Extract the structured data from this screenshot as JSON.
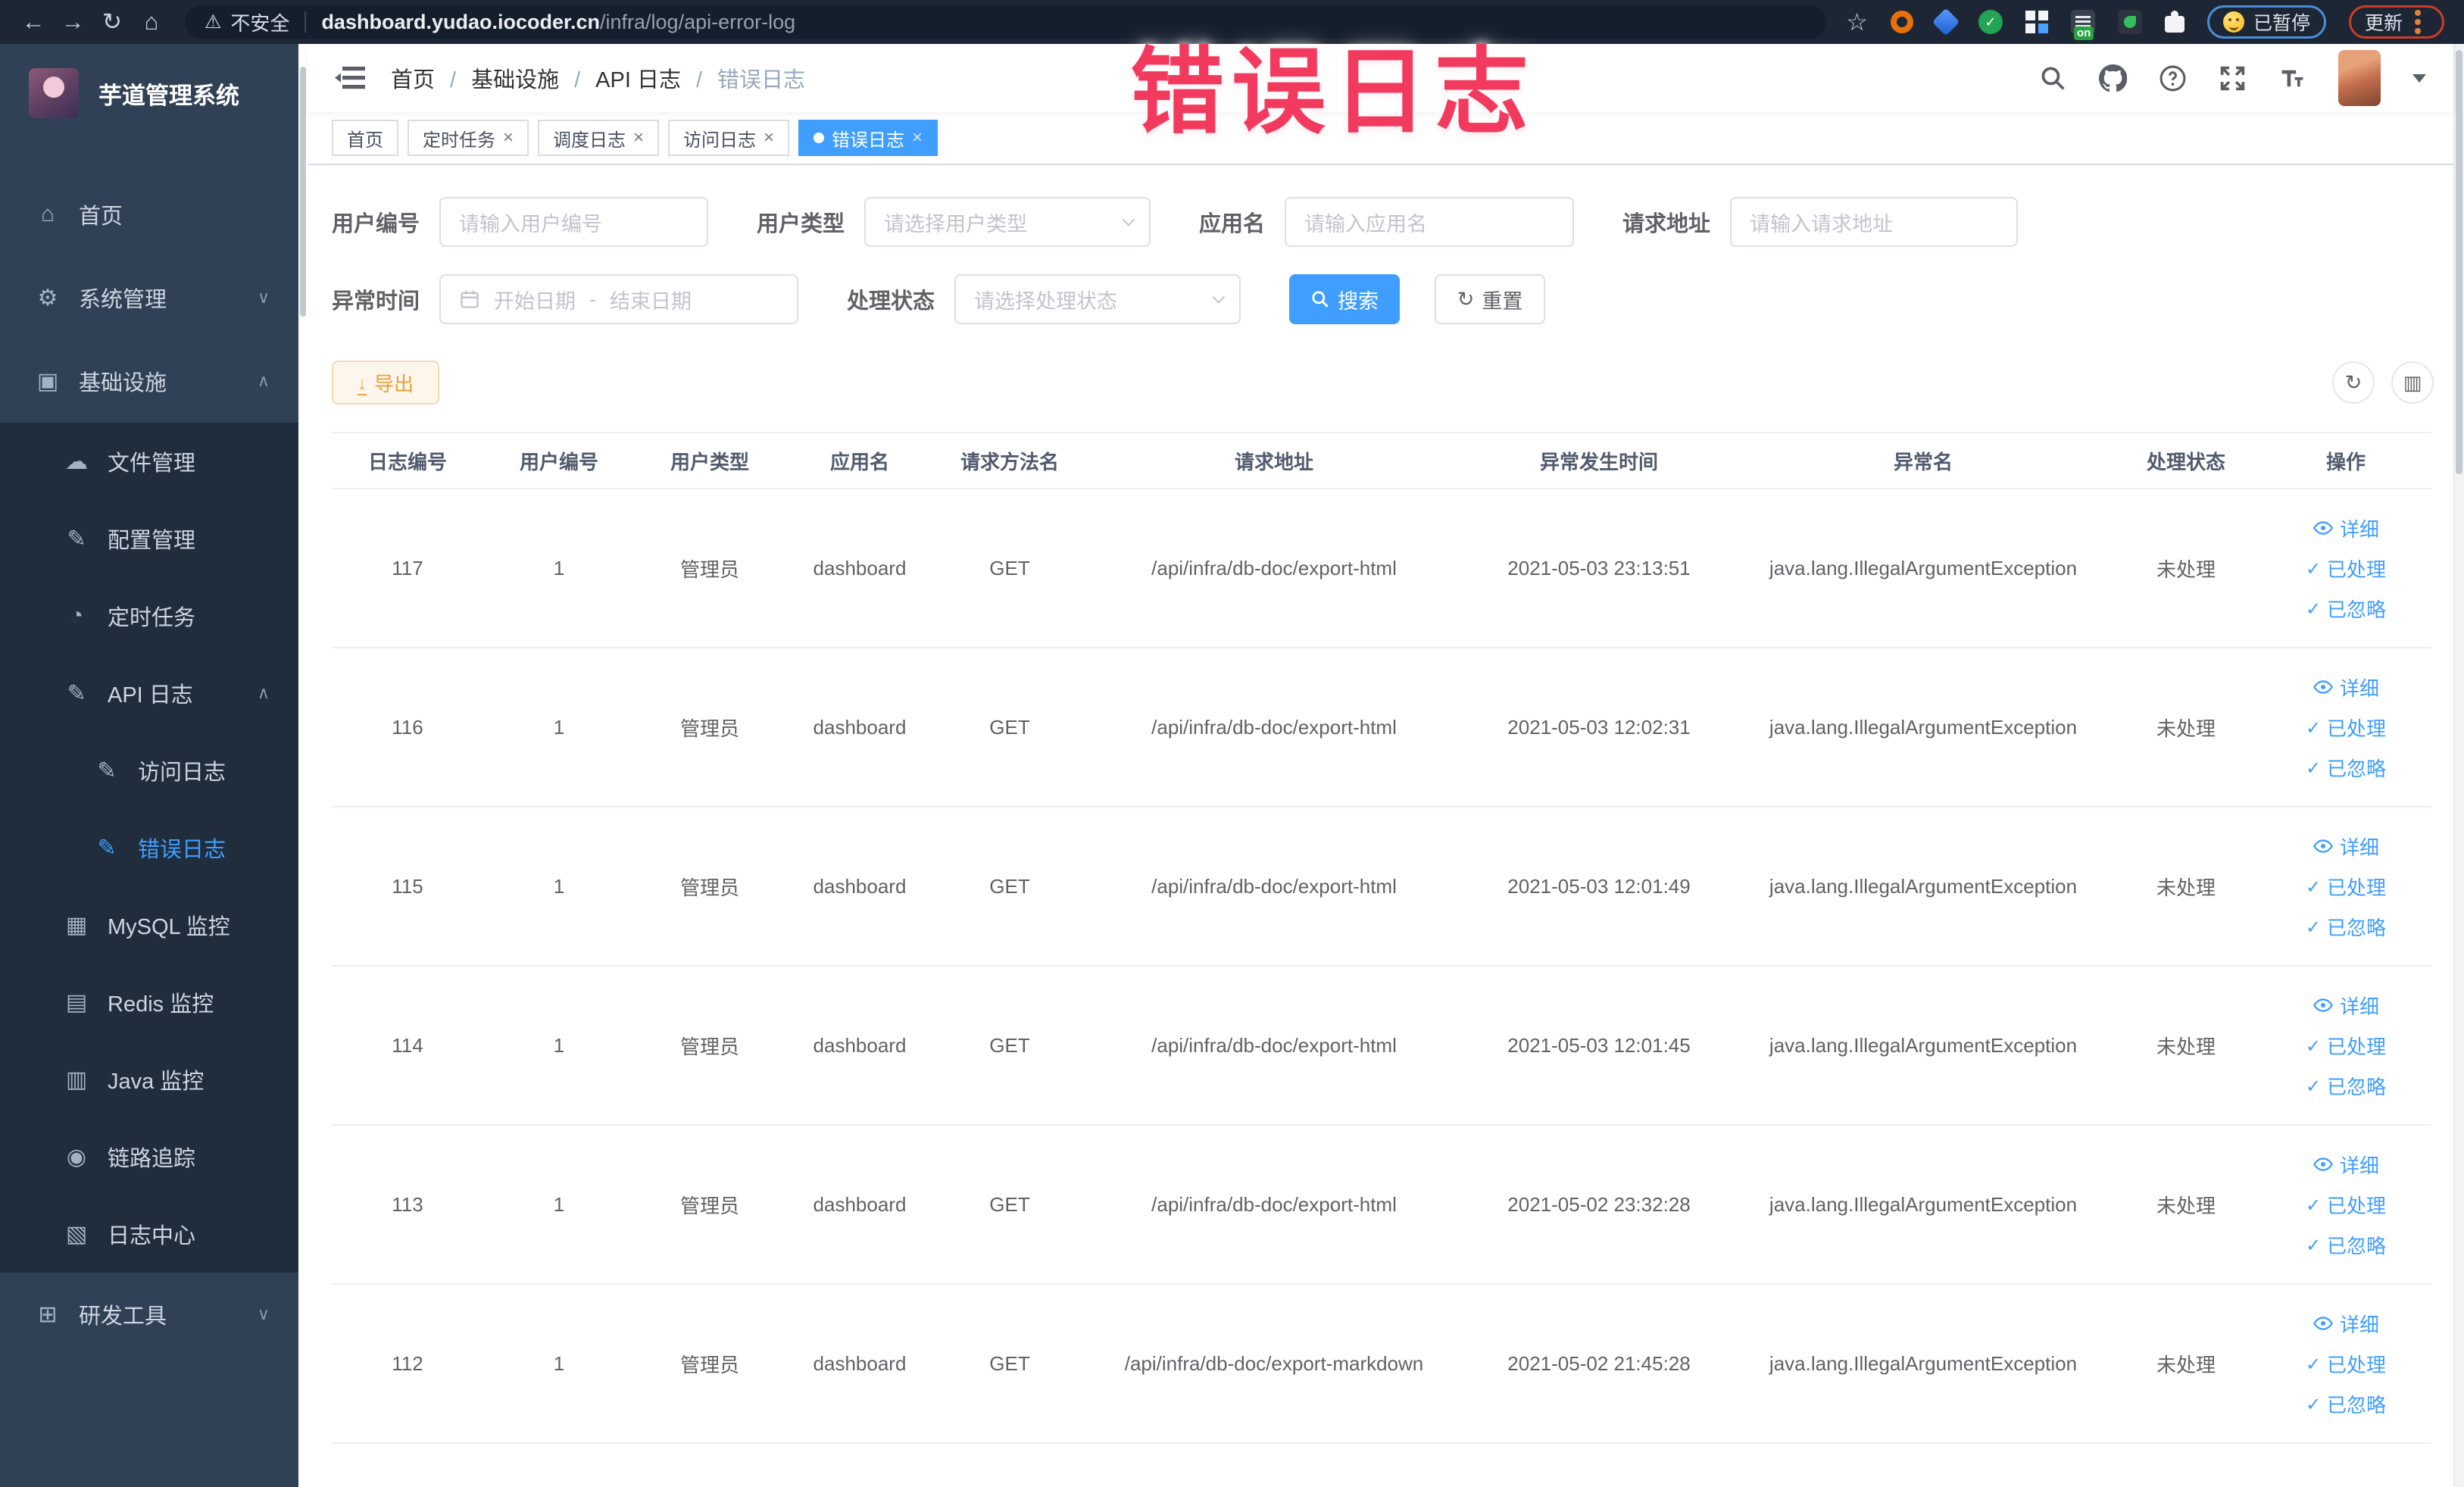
{
  "theme": {
    "primary": "#409eff",
    "warning": "#e6a23c",
    "warning_bg": "#fdf6ec",
    "warning_border": "#f5dab1",
    "watermark": "#f23a5e",
    "sidebar_bg": "#304156",
    "submenu_bg": "#1f2d3d"
  },
  "watermark": "错误日志",
  "browser": {
    "security_label": "不安全",
    "url_host": "dashboard.yudao.iocoder.cn",
    "url_path": "/infra/log/api-error-log",
    "ext_badge": "on",
    "paused_label": "已暂停",
    "update_label": "更新"
  },
  "sidebar": {
    "title": "芋道管理系统",
    "items": [
      {
        "label": "首页",
        "icon": "home",
        "level": 1
      },
      {
        "label": "系统管理",
        "icon": "system",
        "level": 1,
        "chevron_down": true
      },
      {
        "label": "基础设施",
        "icon": "infra",
        "level": 1,
        "chevron_up": true
      },
      {
        "label": "文件管理",
        "icon": "file",
        "level": 2,
        "sub": true
      },
      {
        "label": "配置管理",
        "icon": "config",
        "level": 2,
        "sub": true
      },
      {
        "label": "定时任务",
        "icon": "job",
        "level": 2,
        "sub": true
      },
      {
        "label": "API 日志",
        "icon": "api-log",
        "level": 2,
        "sub": true,
        "chevron_up": true
      },
      {
        "label": "访问日志",
        "icon": "access-log",
        "level": 3,
        "sub": true
      },
      {
        "label": "错误日志",
        "icon": "error-log",
        "level": 3,
        "sub": true,
        "active": true
      },
      {
        "label": "MySQL 监控",
        "icon": "mysql",
        "level": 2,
        "sub": true
      },
      {
        "label": "Redis 监控",
        "icon": "redis",
        "level": 2,
        "sub": true
      },
      {
        "label": "Java 监控",
        "icon": "java",
        "level": 2,
        "sub": true
      },
      {
        "label": "链路追踪",
        "icon": "trace",
        "level": 2,
        "sub": true
      },
      {
        "label": "日志中心",
        "icon": "log-center",
        "level": 2,
        "sub": true
      },
      {
        "label": "研发工具",
        "icon": "dev-tools",
        "level": 1,
        "chevron_down": true
      }
    ]
  },
  "breadcrumb": [
    "首页",
    "基础设施",
    "API 日志",
    "错误日志"
  ],
  "tabs": [
    {
      "label": "首页"
    },
    {
      "label": "定时任务",
      "closable": true
    },
    {
      "label": "调度日志",
      "closable": true
    },
    {
      "label": "访问日志",
      "closable": true
    },
    {
      "label": "错误日志",
      "closable": true,
      "active": true
    }
  ],
  "filters": {
    "user_id": {
      "label": "用户编号",
      "placeholder": "请输入用户编号"
    },
    "user_type": {
      "label": "用户类型",
      "placeholder": "请选择用户类型"
    },
    "app_name": {
      "label": "应用名",
      "placeholder": "请输入应用名"
    },
    "req_url": {
      "label": "请求地址",
      "placeholder": "请输入请求地址"
    },
    "time": {
      "label": "异常时间",
      "start_placeholder": "开始日期",
      "separator": "-",
      "end_placeholder": "结束日期"
    },
    "status": {
      "label": "处理状态",
      "placeholder": "请选择处理状态"
    },
    "search_label": "搜索",
    "reset_label": "重置"
  },
  "toolbar": {
    "export_label": "导出"
  },
  "table": {
    "columns": [
      {
        "label": "日志编号"
      },
      {
        "label": "用户编号"
      },
      {
        "label": "用户类型"
      },
      {
        "label": "应用名"
      },
      {
        "label": "请求方法名"
      },
      {
        "label": "请求地址"
      },
      {
        "label": "异常发生时间"
      },
      {
        "label": "异常名"
      },
      {
        "label": "处理状态"
      },
      {
        "label": "操作"
      }
    ],
    "actions": [
      "详细",
      "已处理",
      "已忽略"
    ],
    "rows": [
      {
        "id": "117",
        "user_id": "1",
        "user_type": "管理员",
        "app": "dashboard",
        "method": "GET",
        "url": "/api/infra/db-doc/export-html",
        "time": "2021-05-03 23:13:51",
        "exception": "java.lang.IllegalArgumentException",
        "status": "未处理"
      },
      {
        "id": "116",
        "user_id": "1",
        "user_type": "管理员",
        "app": "dashboard",
        "method": "GET",
        "url": "/api/infra/db-doc/export-html",
        "time": "2021-05-03 12:02:31",
        "exception": "java.lang.IllegalArgumentException",
        "status": "未处理"
      },
      {
        "id": "115",
        "user_id": "1",
        "user_type": "管理员",
        "app": "dashboard",
        "method": "GET",
        "url": "/api/infra/db-doc/export-html",
        "time": "2021-05-03 12:01:49",
        "exception": "java.lang.IllegalArgumentException",
        "status": "未处理"
      },
      {
        "id": "114",
        "user_id": "1",
        "user_type": "管理员",
        "app": "dashboard",
        "method": "GET",
        "url": "/api/infra/db-doc/export-html",
        "time": "2021-05-03 12:01:45",
        "exception": "java.lang.IllegalArgumentException",
        "status": "未处理"
      },
      {
        "id": "113",
        "user_id": "1",
        "user_type": "管理员",
        "app": "dashboard",
        "method": "GET",
        "url": "/api/infra/db-doc/export-html",
        "time": "2021-05-02 23:32:28",
        "exception": "java.lang.IllegalArgumentException",
        "status": "未处理"
      },
      {
        "id": "112",
        "user_id": "1",
        "user_type": "管理员",
        "app": "dashboard",
        "method": "GET",
        "url": "/api/infra/db-doc/export-markdown",
        "time": "2021-05-02 21:45:28",
        "exception": "java.lang.IllegalArgumentException",
        "status": "未处理"
      }
    ]
  }
}
